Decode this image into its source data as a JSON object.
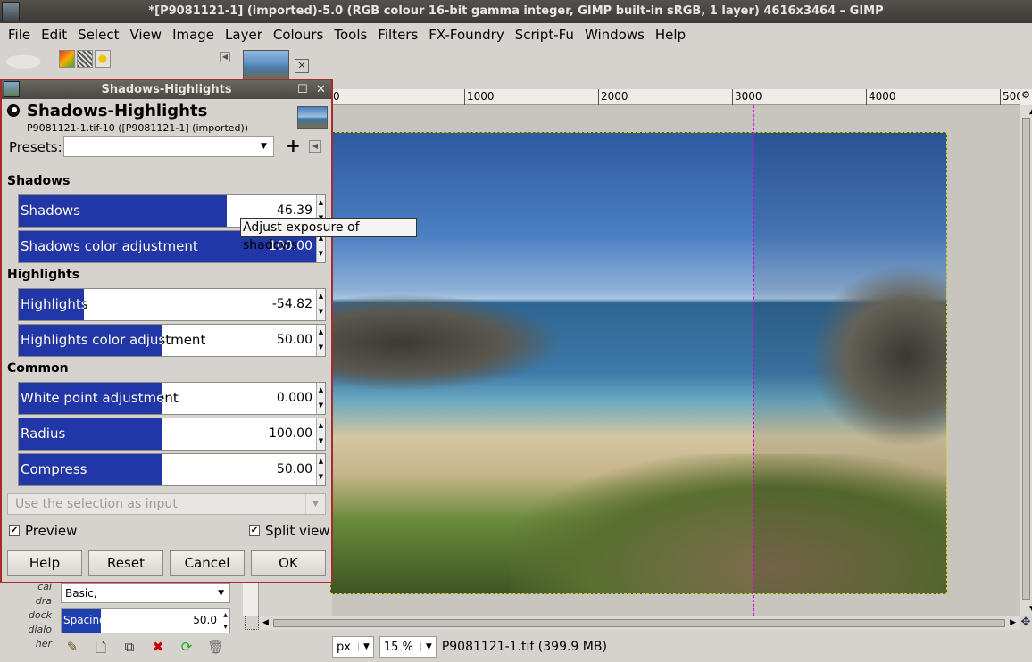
{
  "window": {
    "title": "*[P9081121-1] (imported)-5.0 (RGB colour 16-bit gamma integer, GIMP built-in sRGB, 1 layer) 4616x3464 – GIMP"
  },
  "menubar": {
    "items": [
      "File",
      "Edit",
      "Select",
      "View",
      "Image",
      "Layer",
      "Colours",
      "Tools",
      "Filters",
      "FX-Foundry",
      "Script-Fu",
      "Windows",
      "Help"
    ]
  },
  "ruler": {
    "ticks": [
      "0",
      "1000",
      "2000",
      "3000",
      "4000",
      "500"
    ]
  },
  "dialog": {
    "title": "Shadows-Highlights",
    "heading": "Shadows-Highlights",
    "subtitle": "P9081121-1.tif-10 ([P9081121-1] (imported))",
    "presets_label": "Presets:",
    "presets_value": "",
    "sections": {
      "shadows": "Shadows",
      "highlights": "Highlights",
      "common": "Common"
    },
    "sliders": {
      "shadows": {
        "label": "Shadows",
        "value": "46.39",
        "fraction": 0.7
      },
      "shadows_color": {
        "label": "Shadows color adjustment",
        "value": "100.00",
        "fraction": 1.0
      },
      "highlights": {
        "label": "Highlights",
        "value": "-54.82",
        "fraction": 0.22
      },
      "highlights_color": {
        "label": "Highlights color adjustment",
        "value": "50.00",
        "fraction": 0.48
      },
      "white_point": {
        "label": "White point adjustment",
        "value": "0.000",
        "fraction": 0.48
      },
      "radius": {
        "label": "Radius",
        "value": "100.00",
        "fraction": 0.48
      },
      "compress": {
        "label": "Compress",
        "value": "50.00",
        "fraction": 0.48
      }
    },
    "tooltip": "Adjust exposure of shadows",
    "selection_combo": "Use the selection as input",
    "preview_label": "Preview",
    "preview_checked": true,
    "split_view_label": "Split view",
    "split_view_checked": true,
    "buttons": {
      "help": "Help",
      "reset": "Reset",
      "cancel": "Cancel",
      "ok": "OK"
    }
  },
  "left_dock": {
    "hint_lines": [
      "cai",
      "dra",
      "dock",
      "dialo",
      "her"
    ],
    "brush_preset": "Basic,",
    "spacing_label": "Spacing",
    "spacing_value": "50.0"
  },
  "status": {
    "unit": "px",
    "zoom": "15 %",
    "file_info": "P9081121-1.tif (399.9 MB)"
  },
  "colors": {
    "slider_fill": "#2237a7",
    "dialog_border": "#a92a2a",
    "guide": "#d000d0",
    "titlebar": "#3c3b37"
  }
}
